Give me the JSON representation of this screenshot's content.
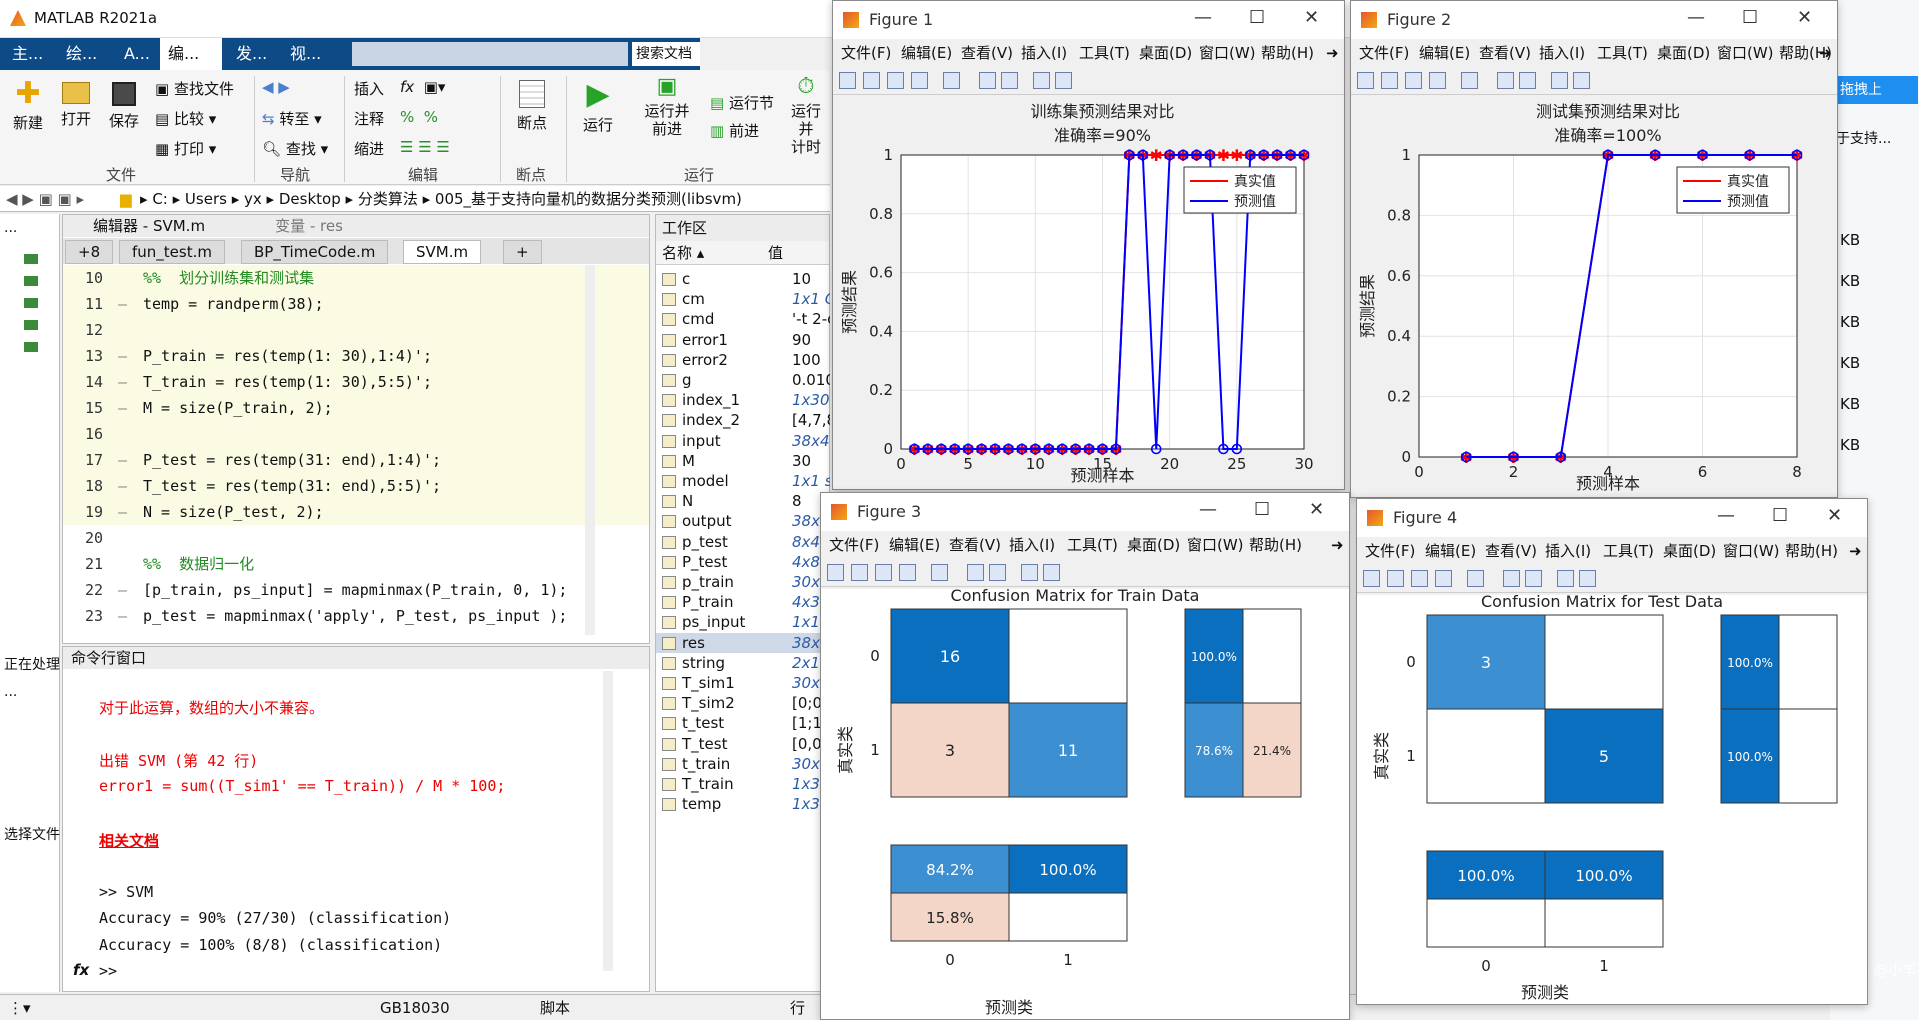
{
  "desktop": {
    "taskbar_text": "CSDN @小羊不会飞"
  },
  "matlab": {
    "title": "MATLAB R2021a",
    "ribbon_tabs": [
      "主...",
      "绘...",
      "A...",
      "编...",
      "发...",
      "视..."
    ],
    "search_placeholder": "搜索文档",
    "ribbon": {
      "new": "新建",
      "open": "打开",
      "save": "保存",
      "find_files": "查找文件",
      "compare": "比较",
      "print": "打印",
      "go_to": "转至",
      "find": "查找",
      "insert": "插入",
      "comment": "注释",
      "indent": "缩进",
      "breakpoints": "断点",
      "run": "运行",
      "run_advance": "运行并\n前进",
      "run_section": "运行节",
      "advance": "前进",
      "run_time": "运行并\n计时",
      "groups": [
        "文件",
        "导航",
        "编辑",
        "断点",
        "运行"
      ]
    },
    "address": [
      "C:",
      "Users",
      "yx",
      "Desktop",
      "分类算法",
      "005_基于支持向量机的数据分类预测(libsvm)"
    ],
    "left_labels": [
      "...",
      "正在处理",
      "...",
      "选择文件"
    ],
    "editor": {
      "title": "编辑器 - SVM.m",
      "variable_tab": "变量 - res",
      "tabs": [
        "+8",
        "fun_test.m",
        "BP_TimeCode.m",
        "SVM.m",
        "+"
      ],
      "lines": [
        {
          "n": "10",
          "d": "",
          "t": "%%  划分训练集和测试集",
          "k": "cmt",
          "cell": true
        },
        {
          "n": "11",
          "d": "—",
          "t": "temp = randperm(38);",
          "k": "",
          "cell": true
        },
        {
          "n": "12",
          "d": "",
          "t": "",
          "k": "",
          "cell": true
        },
        {
          "n": "13",
          "d": "—",
          "t": "P_train = res(temp(1: 30),1:4)';",
          "k": "",
          "cell": true
        },
        {
          "n": "14",
          "d": "—",
          "t": "T_train = res(temp(1: 30),5:5)';",
          "k": "",
          "cell": true
        },
        {
          "n": "15",
          "d": "—",
          "t": "M = size(P_train, 2);",
          "k": "",
          "cell": true
        },
        {
          "n": "16",
          "d": "",
          "t": "",
          "k": "",
          "cell": true
        },
        {
          "n": "17",
          "d": "—",
          "t": "P_test = res(temp(31: end),1:4)';",
          "k": "",
          "cell": true
        },
        {
          "n": "18",
          "d": "—",
          "t": "T_test = res(temp(31: end),5:5)';",
          "k": "",
          "cell": true
        },
        {
          "n": "19",
          "d": "—",
          "t": "N = size(P_test, 2);",
          "k": "",
          "cell": true
        },
        {
          "n": "20",
          "d": "",
          "t": "",
          "k": "",
          "cell": false
        },
        {
          "n": "21",
          "d": "",
          "t": "%%  数据归一化",
          "k": "cmt",
          "cell": false
        },
        {
          "n": "22",
          "d": "—",
          "t": "[p_train, ps_input] = mapminmax(P_train, 0, 1);",
          "k": "",
          "cell": false
        },
        {
          "n": "23",
          "d": "—",
          "t": "p_test = mapminmax('apply', P_test, ps_input );",
          "k": "",
          "cell": false
        }
      ]
    },
    "command": {
      "title": "命令行窗口",
      "lines": [
        {
          "t": "对于此运算，数组的大小不兼容。",
          "c": "red",
          "u": false
        },
        {
          "t": "",
          "c": "",
          "u": false
        },
        {
          "t": "出错 SVM (第 42 行)",
          "c": "red",
          "u": false
        },
        {
          "t": "error1 = sum((T_sim1' == T_train)) / M * 100;",
          "c": "red",
          "u": false
        },
        {
          "t": "",
          "c": "",
          "u": false
        },
        {
          "t": "相关文档",
          "c": "red",
          "u": true
        },
        {
          "t": "",
          "c": "",
          "u": false
        },
        {
          "t": ">> SVM",
          "c": "",
          "u": false
        },
        {
          "t": "Accuracy = 90% (27/30) (classification)",
          "c": "",
          "u": false
        },
        {
          "t": "Accuracy = 100% (8/8) (classification)",
          "c": "",
          "u": false
        },
        {
          "t": ">>",
          "c": "",
          "u": false
        }
      ],
      "prompt_icon": "fx"
    },
    "workspace": {
      "title": "工作区",
      "col_name": "名称 ▴",
      "col_value": "值",
      "rows": [
        [
          "c",
          "10"
        ],
        [
          "cm",
          "1x1 C"
        ],
        [
          "cmd",
          "'-t 2-c"
        ],
        [
          "error1",
          "90"
        ],
        [
          "error2",
          "100"
        ],
        [
          "g",
          "0.010"
        ],
        [
          "index_1",
          "1x30"
        ],
        [
          "index_2",
          "[4,7,8"
        ],
        [
          "input",
          "38x4"
        ],
        [
          "M",
          "30"
        ],
        [
          "model",
          "1x1 struct"
        ],
        [
          "N",
          "8"
        ],
        [
          "output",
          "38x"
        ],
        [
          "p_test",
          "8x4"
        ],
        [
          "P_test",
          "4x8"
        ],
        [
          "p_train",
          "30x"
        ],
        [
          "P_train",
          "4x3"
        ],
        [
          "ps_input",
          "1x1"
        ],
        [
          "res",
          "38x"
        ],
        [
          "string",
          "2x1"
        ],
        [
          "T_sim1",
          "30x"
        ],
        [
          "T_sim2",
          "[0;0"
        ],
        [
          "t_test",
          "[1;1"
        ],
        [
          "T_test",
          "[0,0"
        ],
        [
          "t_train",
          "30x"
        ],
        [
          "T_train",
          "1x3"
        ],
        [
          "temp",
          "1x3"
        ]
      ]
    },
    "status": {
      "encoding": "GB18030",
      "type": "脚本",
      "row": "行"
    }
  },
  "fig_menu": [
    "文件(F)",
    "编辑(E)",
    "查看(V)",
    "插入(I)",
    "工具(T)",
    "桌面(D)",
    "窗口(W)",
    "帮助(H)"
  ],
  "figure1": {
    "title": "Figure 1",
    "chart_data": {
      "type": "line",
      "title": "训练集预测结果对比",
      "subtitle": "准确率=90%",
      "xlabel": "预测样本",
      "ylabel": "预测结果",
      "xlim": [
        0,
        30
      ],
      "ylim": [
        0,
        1
      ],
      "xticks": [
        0,
        5,
        10,
        15,
        20,
        25,
        30
      ],
      "yticks": [
        0,
        0.2,
        0.4,
        0.6,
        0.8,
        1
      ],
      "grid": true,
      "legend": "top-right",
      "x": [
        1,
        2,
        3,
        4,
        5,
        6,
        7,
        8,
        9,
        10,
        11,
        12,
        13,
        14,
        15,
        16,
        17,
        18,
        19,
        20,
        21,
        22,
        23,
        24,
        25,
        26,
        27,
        28,
        29,
        30
      ],
      "series": [
        {
          "name": "真实值",
          "color": "#ff0000",
          "marker": "*",
          "values": [
            0,
            0,
            0,
            0,
            0,
            0,
            0,
            0,
            0,
            0,
            0,
            0,
            0,
            0,
            0,
            0,
            1,
            1,
            1,
            1,
            1,
            1,
            1,
            1,
            1,
            1,
            1,
            1,
            1,
            1
          ]
        },
        {
          "name": "预测值",
          "color": "#0000ff",
          "marker": "o",
          "values": [
            0,
            0,
            0,
            0,
            0,
            0,
            0,
            0,
            0,
            0,
            0,
            0,
            0,
            0,
            0,
            0,
            1,
            1,
            0,
            1,
            1,
            1,
            1,
            0,
            0,
            1,
            1,
            1,
            1,
            1
          ]
        }
      ]
    }
  },
  "figure2": {
    "title": "Figure 2",
    "chart_data": {
      "type": "line",
      "title": "测试集预测结果对比",
      "subtitle": "准确率=100%",
      "xlabel": "预测样本",
      "ylabel": "预测结果",
      "xlim": [
        0,
        8
      ],
      "ylim": [
        0,
        1
      ],
      "xticks": [
        0,
        2,
        4,
        6,
        8
      ],
      "yticks": [
        0,
        0.2,
        0.4,
        0.6,
        0.8,
        1
      ],
      "grid": true,
      "legend": "top-right",
      "x": [
        1,
        2,
        3,
        4,
        5,
        6,
        7,
        8
      ],
      "series": [
        {
          "name": "真实值",
          "color": "#ff0000",
          "marker": "*",
          "values": [
            0,
            0,
            0,
            1,
            1,
            1,
            1,
            1
          ]
        },
        {
          "name": "预测值",
          "color": "#0000ff",
          "marker": "o",
          "values": [
            0,
            0,
            0,
            1,
            1,
            1,
            1,
            1
          ]
        }
      ]
    }
  },
  "figure3": {
    "title": "Figure 3",
    "chart_data": {
      "type": "heatmap",
      "title": "Confusion Matrix for Train Data",
      "xlabel": "预测类",
      "ylabel": "真实类",
      "classes": [
        "0",
        "1"
      ],
      "matrix": [
        [
          16,
          0
        ],
        [
          3,
          11
        ]
      ],
      "row_summary": [
        [
          "100.0%",
          ""
        ],
        [
          "78.6%",
          "21.4%"
        ]
      ],
      "col_summary": [
        [
          "84.2%",
          "100.0%"
        ],
        [
          "15.8%",
          ""
        ]
      ]
    }
  },
  "figure4": {
    "title": "Figure 4",
    "chart_data": {
      "type": "heatmap",
      "title": "Confusion Matrix for Test Data",
      "xlabel": "预测类",
      "ylabel": "真实类",
      "classes": [
        "0",
        "1"
      ],
      "matrix": [
        [
          3,
          0
        ],
        [
          0,
          5
        ]
      ],
      "row_summary": [
        [
          "100.0%",
          ""
        ],
        [
          "100.0%",
          ""
        ]
      ],
      "col_summary": [
        [
          "100.0%",
          "100.0%"
        ],
        [
          "",
          ""
        ]
      ]
    }
  },
  "right_panel": {
    "kb": "KB",
    "support": "于支持...",
    "button": "拖拽上"
  }
}
